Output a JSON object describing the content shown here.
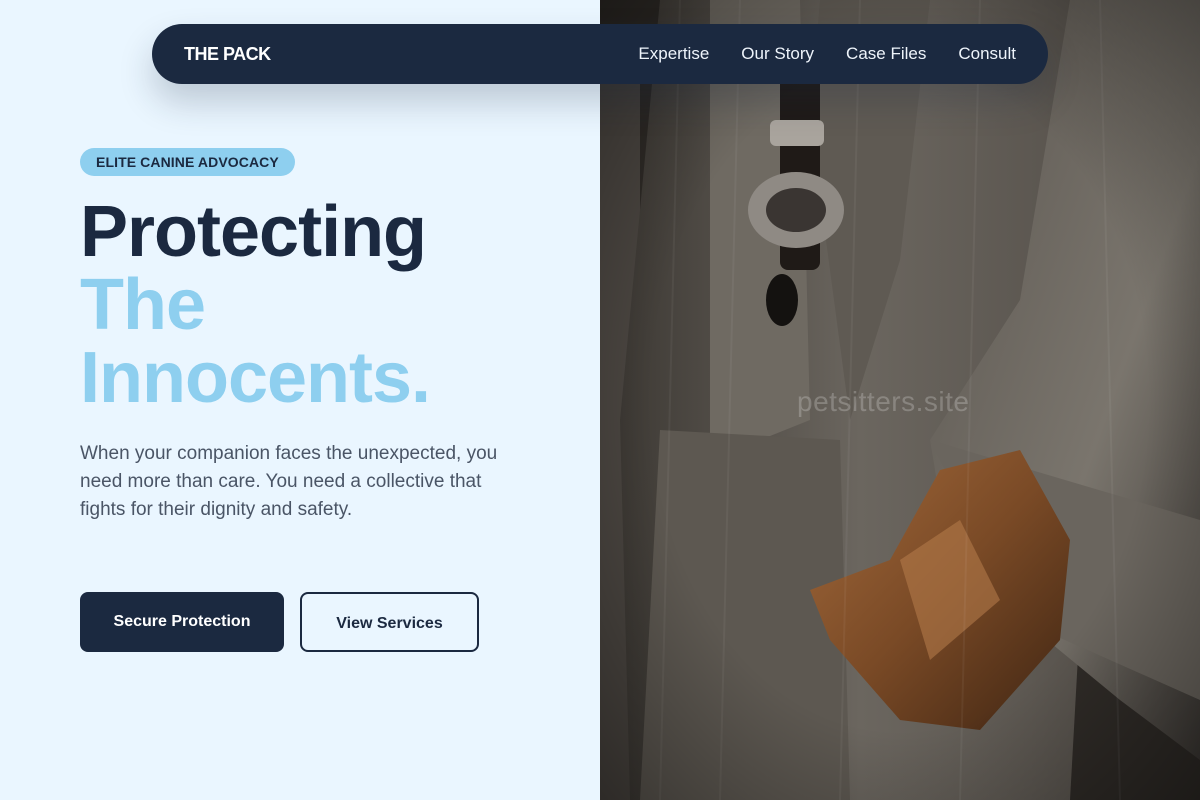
{
  "nav": {
    "brand": "THE PACK",
    "links": [
      "Expertise",
      "Our Story",
      "Case Files",
      "Consult"
    ]
  },
  "hero": {
    "badge": "ELITE CANINE ADVOCACY",
    "headline_line1": "Protecting",
    "headline_line2": "The",
    "headline_line3": "Innocents.",
    "subcopy": "When your companion faces the unexpected, you need more than care. You need a collective that fights for their dignity and safety.",
    "primary_cta": "Secure Protection",
    "secondary_cta": "View Services"
  },
  "image": {
    "description_icon": "suited-figure-photo",
    "watermark": "petsitters.site"
  },
  "colors": {
    "navy": "#1b2940",
    "accent_light_blue": "#8ecfef",
    "background": "#eaf6ff",
    "body_text": "#4a5566"
  }
}
